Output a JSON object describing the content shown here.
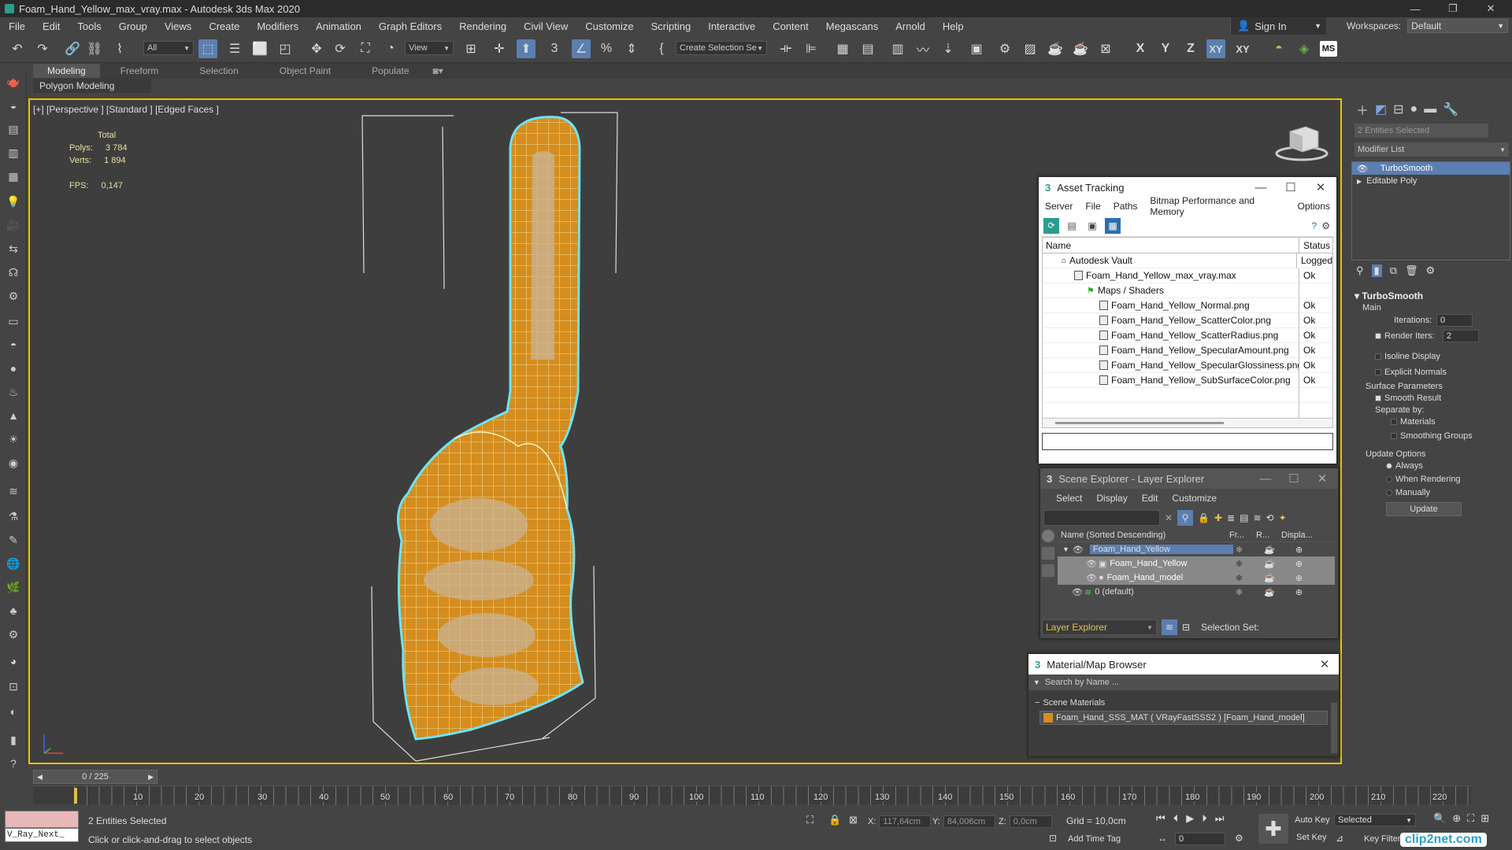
{
  "title": "Foam_Hand_Yellow_max_vray.max - Autodesk 3ds Max 2020",
  "menu": [
    "File",
    "Edit",
    "Tools",
    "Group",
    "Views",
    "Create",
    "Modifiers",
    "Animation",
    "Graph Editors",
    "Rendering",
    "Civil View",
    "Customize",
    "Scripting",
    "Interactive",
    "Content",
    "Megascans",
    "Arnold",
    "Help"
  ],
  "signin": "Sign In",
  "workspaces_label": "Workspaces:",
  "workspaces_value": "Default",
  "toolbar": {
    "filter": "All",
    "view": "View",
    "selset": "Create Selection Se",
    "axis": [
      "X",
      "Y",
      "Z",
      "XY",
      "XY"
    ],
    "ms": "MS"
  },
  "ribbon": {
    "tabs": [
      "Modeling",
      "Freeform",
      "Selection",
      "Object Paint",
      "Populate"
    ],
    "sub": "Polygon Modeling"
  },
  "viewport": {
    "label": "[+] [Perspective ] [Standard ] [Edged Faces ]",
    "stats": {
      "total": "Total",
      "polys_label": "Polys:",
      "polys": "3 784",
      "verts_label": "Verts:",
      "verts": "1 894",
      "fps_label": "FPS:",
      "fps": "0,147"
    }
  },
  "asset_tracking": {
    "title": "Asset Tracking",
    "menu": [
      "Server",
      "File",
      "Paths",
      "Bitmap Performance and Memory",
      "Options"
    ],
    "col_name": "Name",
    "col_status": "Status",
    "rows": [
      {
        "name": "Autodesk Vault",
        "status": "Logged",
        "indent": 0
      },
      {
        "name": "Foam_Hand_Yellow_max_vray.max",
        "status": "Ok",
        "indent": 1
      },
      {
        "name": "Maps / Shaders",
        "status": "",
        "indent": 2
      },
      {
        "name": "Foam_Hand_Yellow_Normal.png",
        "status": "Ok",
        "indent": 3
      },
      {
        "name": "Foam_Hand_Yellow_ScatterColor.png",
        "status": "Ok",
        "indent": 3
      },
      {
        "name": "Foam_Hand_Yellow_ScatterRadius.png",
        "status": "Ok",
        "indent": 3
      },
      {
        "name": "Foam_Hand_Yellow_SpecularAmount.png",
        "status": "Ok",
        "indent": 3
      },
      {
        "name": "Foam_Hand_Yellow_SpecularGlossiness.png",
        "status": "Ok",
        "indent": 3
      },
      {
        "name": "Foam_Hand_Yellow_SubSurfaceColor.png",
        "status": "Ok",
        "indent": 3
      }
    ]
  },
  "scene_explorer": {
    "title": "Scene Explorer - Layer Explorer",
    "menu": [
      "Select",
      "Display",
      "Edit",
      "Customize"
    ],
    "col_name": "Name (Sorted Descending)",
    "col_fr": "Fr...",
    "col_r": "R...",
    "col_disp": "Displa...",
    "rows": [
      "Foam_Hand_Yellow",
      "Foam_Hand_Yellow",
      "Foam_Hand_model",
      "0 (default)"
    ],
    "layer_dropdown": "Layer Explorer",
    "selection_set": "Selection Set:"
  },
  "material_browser": {
    "title": "Material/Map Browser",
    "search": "Search by Name ...",
    "section": "Scene Materials",
    "item": "Foam_Hand_SSS_MAT ( VRayFastSSS2 ) [Foam_Hand_model]"
  },
  "command_panel": {
    "entities": "2 Entities Selected",
    "modifier_list": "Modifier List",
    "stack": [
      "TurboSmooth",
      "Editable Poly"
    ],
    "rollout": "TurboSmooth",
    "main": "Main",
    "iterations_label": "Iterations:",
    "iterations": "0",
    "render_iters_label": "Render Iters:",
    "render_iters": "2",
    "isoline": "Isoline Display",
    "explicit": "Explicit Normals",
    "surface": "Surface Parameters",
    "smooth_result": "Smooth Result",
    "separate": "Separate by:",
    "materials": "Materials",
    "smoothing": "Smoothing Groups",
    "update_options": "Update Options",
    "always": "Always",
    "when_rendering": "When Rendering",
    "manually": "Manually",
    "update": "Update"
  },
  "timeline": {
    "frame": "0 / 225",
    "ticks": [
      "10",
      "20",
      "30",
      "40",
      "50",
      "60",
      "70",
      "80",
      "90",
      "100",
      "110",
      "120",
      "130",
      "140",
      "150",
      "160",
      "170",
      "180",
      "190",
      "200",
      "210",
      "220"
    ]
  },
  "status": {
    "script": "V_Ray_Next_",
    "selected": "2 Entities Selected",
    "prompt": "Click or click-and-drag to select objects",
    "x_label": "X:",
    "x": "117,64cm",
    "y_label": "Y:",
    "y": "84,006cm",
    "z_label": "Z:",
    "z": "0,0cm",
    "grid": "Grid = 10,0cm",
    "add_time_tag": "Add Time Tag",
    "auto_key": "Auto Key",
    "set_key": "Set Key",
    "selected_drop": "Selected",
    "key_filters": "Key Filters...",
    "frame_field": "0"
  },
  "watermark": "clip2net.com"
}
